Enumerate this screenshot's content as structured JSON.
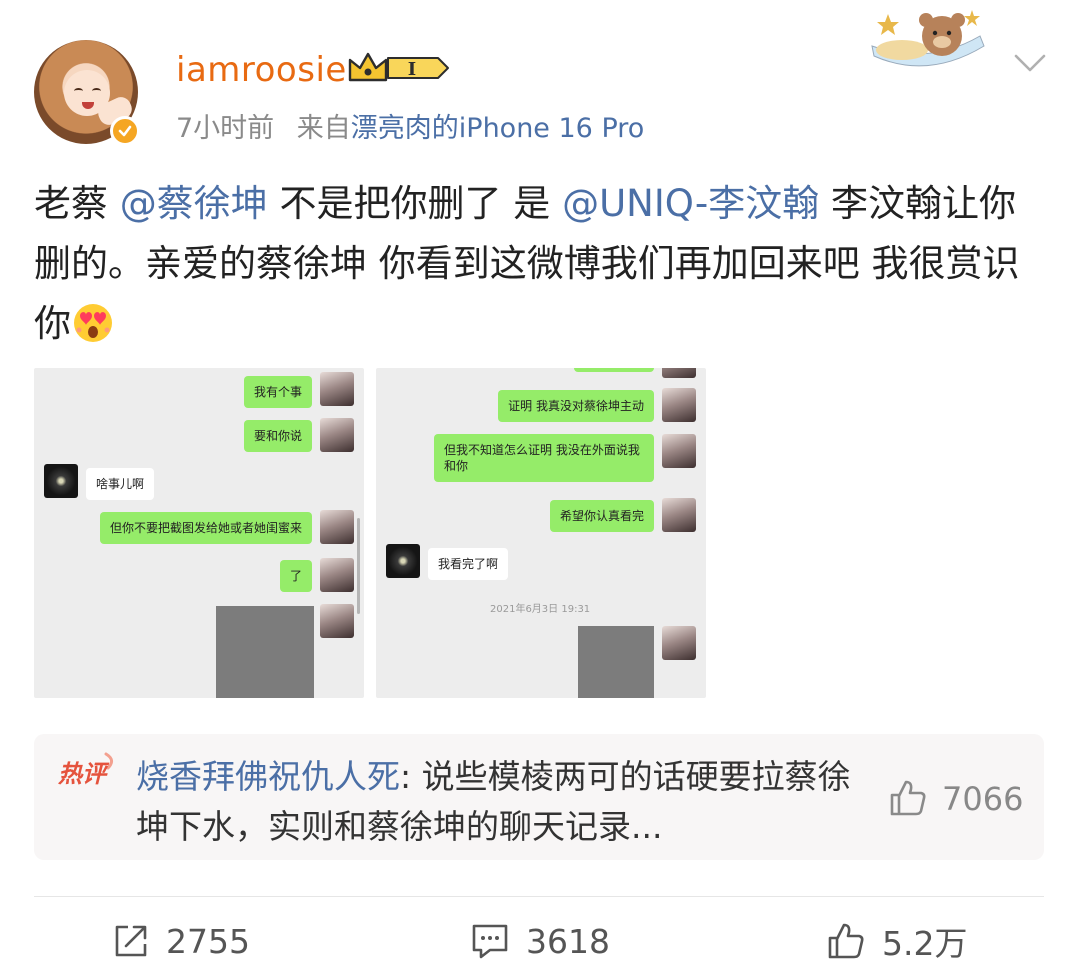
{
  "header": {
    "username": "iamroosie",
    "level_badge": "I",
    "time": "7小时前",
    "source_prefix": "来自",
    "source_device": "漂亮肉的iPhone 16 Pro"
  },
  "post": {
    "p1": "老蔡 ",
    "mention1": "@蔡徐坤",
    "p2": " 不是把你删了 是 ",
    "mention2": "@UNIQ-李汶翰",
    "p3": " 李汶翰让你删的。亲爱的蔡徐坤 你看到这微博我们再加回来吧 我很赏识你",
    "emoji": "heart-eyes-emoji"
  },
  "images": {
    "left": {
      "msg1": "我有个事",
      "msg2": "要和你说",
      "reply1": "啥事儿啊",
      "msg3": "但你不要把截图发给她或者她闺蜜来",
      "msg4": "了"
    },
    "right": {
      "msg1": "证明 我真没对蔡徐坤主动",
      "msg2": "但我不知道怎么证明 我没在外面说我和你",
      "msg3": "希望你认真看完",
      "reply1": "我看完了啊",
      "timestamp": "2021年6月3日 19:31"
    }
  },
  "hot_comment": {
    "tag": "热评",
    "author": "烧香拜佛祝仇人死",
    "text": ": 说些模棱两可的话硬要拉蔡徐坤下水，实则和蔡徐坤的聊天记录...",
    "likes": "7066"
  },
  "actions": {
    "repost_count": "2755",
    "comment_count": "3618",
    "like_count": "5.2万"
  },
  "colors": {
    "username": "#e86a12",
    "link": "#4b6fa6",
    "bubble_green": "#95ec69",
    "hot_tag": "#e5533d"
  }
}
